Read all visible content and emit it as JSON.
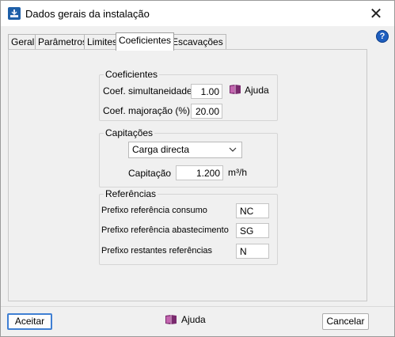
{
  "window": {
    "title": "Dados gerais da instalação",
    "close_glyph": "✕",
    "help_glyph": "?"
  },
  "tabs": [
    {
      "label": "Geral"
    },
    {
      "label": "Parâmetros"
    },
    {
      "label": "Limites"
    },
    {
      "label": "Coeficientes"
    },
    {
      "label": "Escavações"
    }
  ],
  "coeficientes": {
    "title": "Coeficientes",
    "simultaneidade_label": "Coef. simultaneidade",
    "simultaneidade_value": "1.00",
    "majoracao_label": "Coef. majoração (%)",
    "majoracao_value": "20.00",
    "help_label": "Ajuda"
  },
  "capitacoes": {
    "title": "Capitações",
    "select_value": "Carga directa",
    "capitacao_label": "Capitação",
    "capitacao_value": "1.200",
    "unit": "m³/h"
  },
  "referencias": {
    "title": "Referências",
    "consumo_label": "Prefixo referência consumo",
    "consumo_value": "NC",
    "abastecimento_label": "Prefixo referência abastecimento",
    "abastecimento_value": "SG",
    "restantes_label": "Prefixo restantes referências",
    "restantes_value": "N"
  },
  "footer": {
    "accept_label": "Aceitar",
    "help_label": "Ajuda",
    "cancel_label": "Cancelar"
  },
  "colors": {
    "accent": "#3f7fd3",
    "help_icon": "#1f5fbf",
    "book": "#7a2a6e"
  },
  "icons": {
    "app": "app-icon",
    "help": "help-question-icon",
    "book": "book-icon",
    "close": "close-icon",
    "dropdown": "chevron-down-icon"
  }
}
